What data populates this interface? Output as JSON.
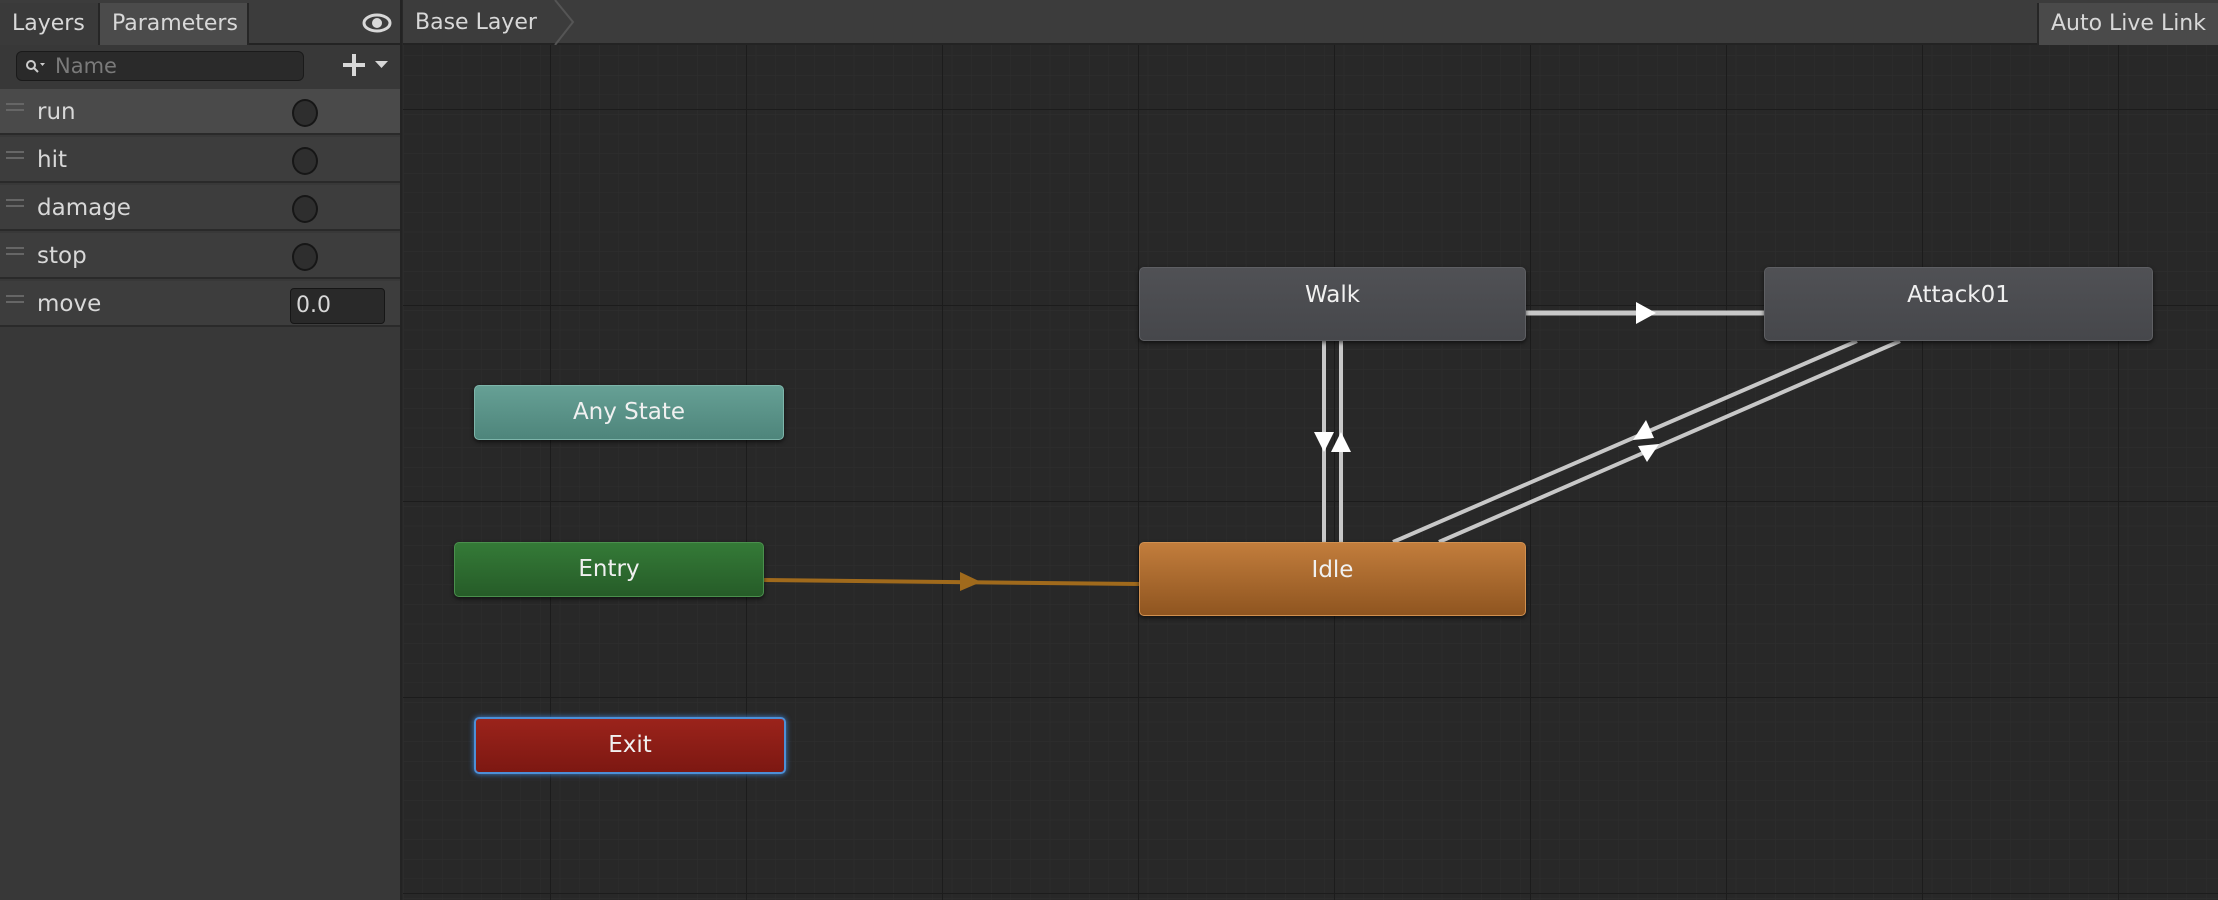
{
  "panel": {
    "tabs": [
      {
        "label": "Layers"
      },
      {
        "label": "Parameters"
      }
    ],
    "active_tab": "Parameters",
    "search_placeholder": "Name",
    "parameters": [
      {
        "name": "run",
        "type": "trigger"
      },
      {
        "name": "hit",
        "type": "trigger"
      },
      {
        "name": "damage",
        "type": "trigger"
      },
      {
        "name": "stop",
        "type": "trigger"
      },
      {
        "name": "move",
        "type": "float",
        "value": "0.0"
      }
    ]
  },
  "breadcrumb": "Base Layer",
  "auto_live_link": "Auto Live Link",
  "states": {
    "walk": "Walk",
    "attack": "Attack01",
    "idle": "Idle",
    "any": "Any State",
    "entry": "Entry",
    "exit": "Exit"
  },
  "colors": {
    "default_state": "#4b4c50",
    "idle": "#b8743a",
    "any_state": "#5b9288",
    "entry": "#2f6e32",
    "exit": "#8e1f18",
    "transition": "#c8c8c8",
    "entry_transition": "#a06a1c"
  }
}
